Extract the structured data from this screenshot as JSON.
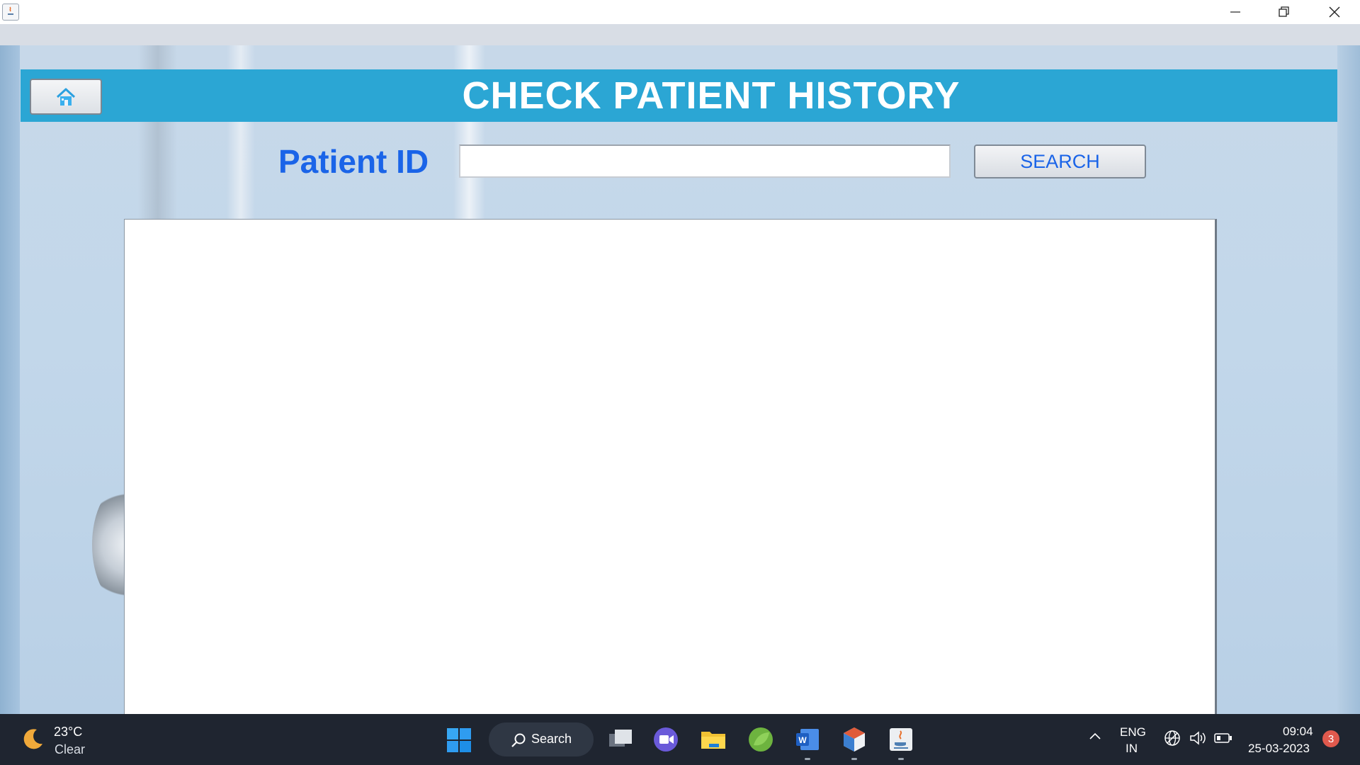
{
  "window": {
    "app_icon": "java-app-icon",
    "controls": [
      "minimize-icon",
      "restore-icon",
      "close-icon"
    ]
  },
  "header": {
    "title": "CHECK PATIENT HISTORY",
    "home_icon": "home-icon",
    "bar_color": "#2ba6d4"
  },
  "search": {
    "label": "Patient ID",
    "value": "",
    "placeholder": "",
    "button_label": "SEARCH",
    "accent_color": "#1a64e8"
  },
  "history": {
    "content": ""
  },
  "taskbar": {
    "weather": {
      "icon": "moon-icon",
      "temp": "23°C",
      "condition": "Clear"
    },
    "search_label": "Search",
    "apps": [
      "task-view-icon",
      "teams-meet-icon",
      "file-explorer-icon",
      "spring-tools-icon",
      "word-icon",
      "netbeans-icon",
      "java-icon"
    ],
    "language": {
      "line1": "ENG",
      "line2": "IN"
    },
    "tray_icons": [
      "network-icon",
      "volume-icon",
      "battery-icon"
    ],
    "time": "09:04",
    "date": "25-03-2023",
    "notification_count": "3"
  }
}
